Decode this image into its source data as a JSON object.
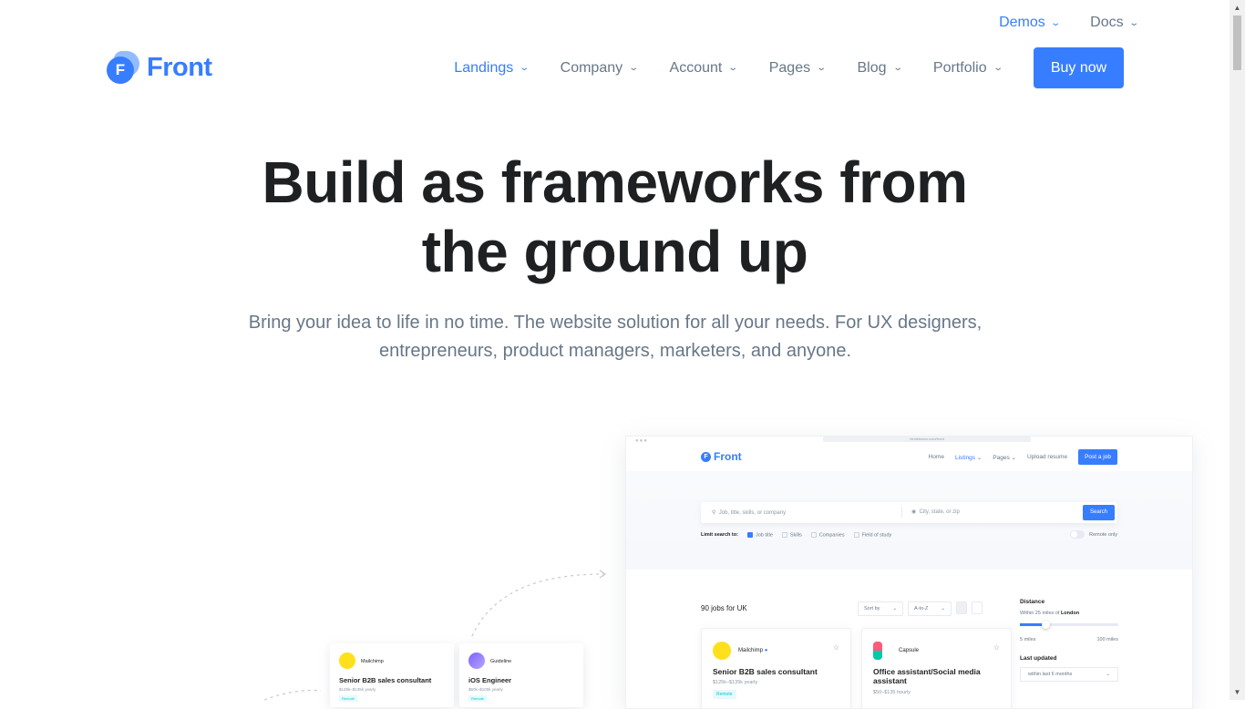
{
  "topbar": {
    "demos": "Demos",
    "docs": "Docs"
  },
  "brand": {
    "name": "Front",
    "mark": "F"
  },
  "nav": {
    "items": [
      "Landings",
      "Company",
      "Account",
      "Pages",
      "Blog",
      "Portfolio"
    ],
    "buy": "Buy now"
  },
  "hero": {
    "title_line1": "Build as frameworks from",
    "title_line2": "the ground up",
    "subtitle": "Bring your idea to life in no time. The website solution for all your needs. For UX designers, entrepreneurs, product managers, marketers, and anyone."
  },
  "mockup": {
    "brand": "Front",
    "url": "htmlstream.com/front",
    "nav": {
      "home": "Home",
      "listings": "Listings",
      "pages": "Pages",
      "upload": "Upload resume",
      "post": "Post a job"
    },
    "search": {
      "what": "Job, title, skills, or company",
      "where": "City, state, or zip",
      "button": "Search"
    },
    "filters": {
      "label": "Limit search to:",
      "job_title": "Job title",
      "skills": "Skills",
      "companies": "Companies",
      "field": "Field of study",
      "remote": "Remote only"
    },
    "results": {
      "count": "90 jobs for UK",
      "sort": "Sort by",
      "order": "A-to-Z"
    },
    "side": {
      "distance": "Distance",
      "within_prefix": "Within 25 miles of ",
      "within_city": "London",
      "min": "5 miles",
      "max": "100 miles",
      "last_updated": "Last updated",
      "last_value": "within last 6 months"
    },
    "cards": [
      {
        "company": "Mailchimp",
        "title": "Senior B2B sales consultant",
        "pay": "$125k–$135k yearly",
        "badge": "Remote"
      },
      {
        "company": "Capsule",
        "title": "Office assistant/Social media assistant",
        "pay": "$50–$135 hourly"
      }
    ]
  },
  "side_cards": [
    {
      "company": "Mailchimp",
      "title": "Senior B2B sales consultant",
      "pay": "$125k–$135k yearly",
      "badge": "Remote"
    },
    {
      "company": "Guideline",
      "title": "iOS Engineer",
      "pay": "$50k–$100k yearly",
      "badge": "Remote"
    }
  ],
  "colors": {
    "primary": "#377dff",
    "text": "#1e2022",
    "muted": "#677788"
  }
}
